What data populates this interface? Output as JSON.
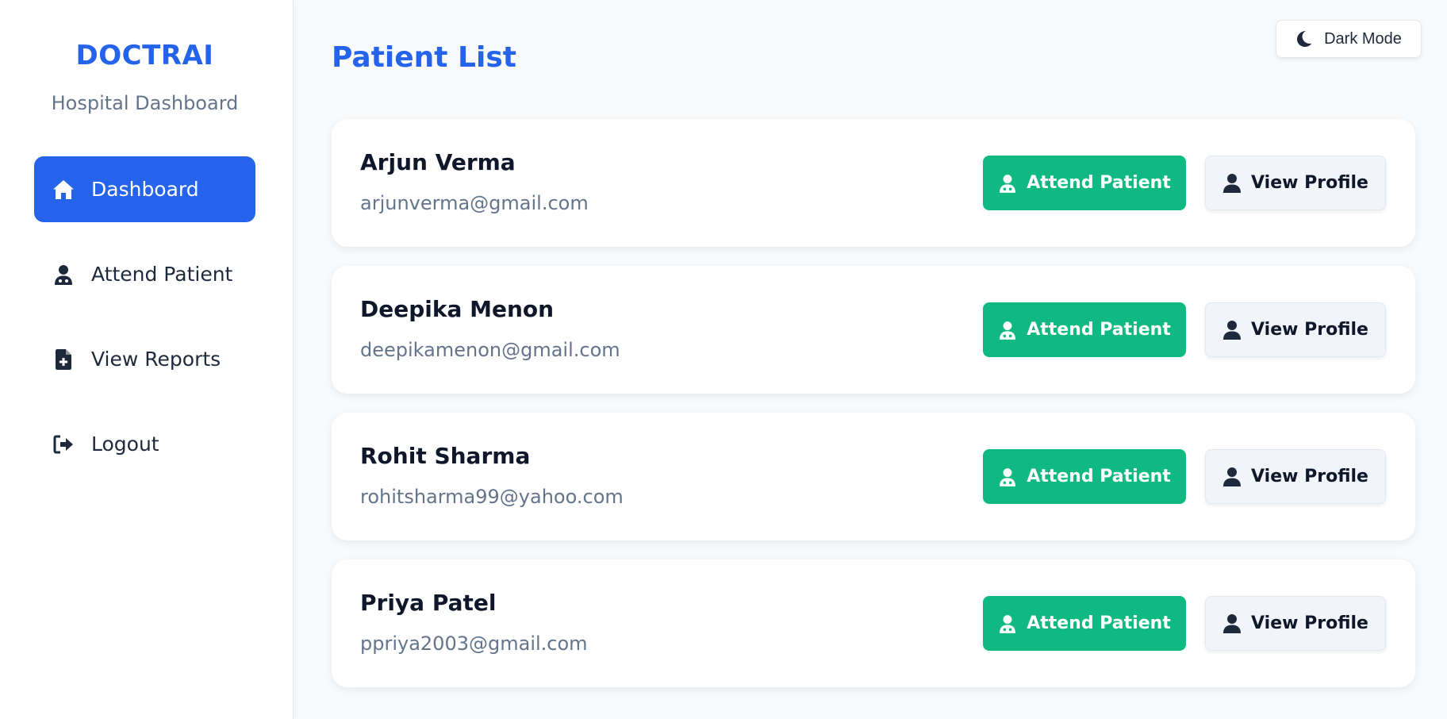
{
  "sidebar": {
    "brand": "DOCTRAI",
    "subtitle": "Hospital Dashboard",
    "items": [
      {
        "label": "Dashboard",
        "icon": "home-icon",
        "active": true
      },
      {
        "label": "Attend Patient",
        "icon": "doctor-icon",
        "active": false
      },
      {
        "label": "View Reports",
        "icon": "file-medical-icon",
        "active": false
      },
      {
        "label": "Logout",
        "icon": "logout-icon",
        "active": false
      }
    ]
  },
  "header": {
    "title": "Patient List",
    "dark_mode_label": "Dark Mode",
    "dark_mode_icon": "moon-icon"
  },
  "actions": {
    "attend_label": "Attend Patient",
    "view_label": "View Profile"
  },
  "patients": [
    {
      "name": "Arjun Verma",
      "email": "arjunverma@gmail.com"
    },
    {
      "name": "Deepika Menon",
      "email": "deepikamenon@gmail.com"
    },
    {
      "name": "Rohit Sharma",
      "email": "rohitsharma99@yahoo.com"
    },
    {
      "name": "Priya Patel",
      "email": "ppriya2003@gmail.com"
    }
  ],
  "colors": {
    "primary": "#2563eb",
    "success": "#10b981",
    "text_muted": "#64748b",
    "background": "#f8fafc"
  }
}
